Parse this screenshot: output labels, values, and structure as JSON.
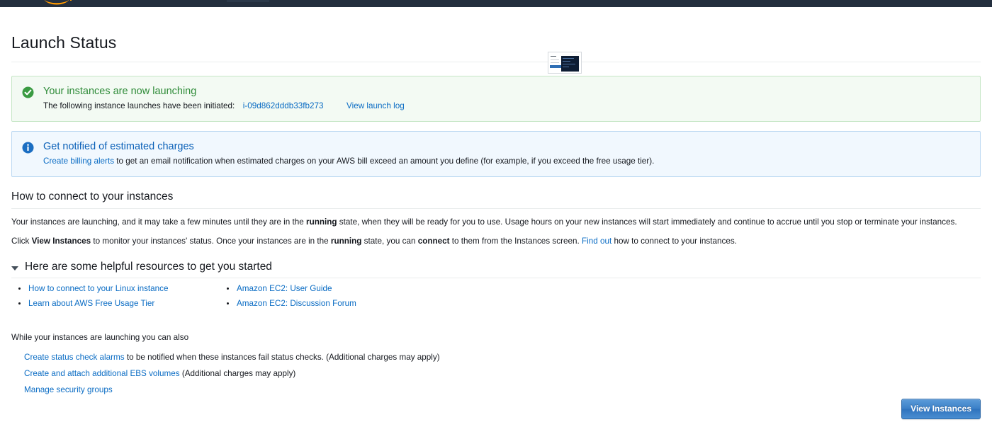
{
  "topbar": {
    "logo_label": "aws-smile-logo",
    "logo_color": "#ff9900",
    "background": "#232f3e"
  },
  "page": {
    "title": "Launch Status"
  },
  "thumbnail": {
    "label": "console-preview-thumbnail"
  },
  "success_alert": {
    "icon": "check-circle-icon",
    "icon_color": "#2e8b38",
    "heading": "Your instances are now launching",
    "description_prefix": "The following instance launches have been initiated:",
    "instance_id": "i-09d862dddb33fb273",
    "log_link": "View launch log"
  },
  "info_alert": {
    "icon": "info-circle-icon",
    "icon_color": "#1b6ec2",
    "heading": "Get notified of estimated charges",
    "link": "Create billing alerts",
    "description": "to get an email notification when estimated charges on your AWS bill exceed an amount you define (for example, if you exceed the free usage tier)."
  },
  "connect_section": {
    "heading": "How to connect to your instances",
    "paragraph1": {
      "part1": "Your instances are launching, and it may take a few minutes until they are in the",
      "bold1": "running",
      "part2": "state, when they will be ready for you to use. Usage hours on your new instances will start immediately and continue to accrue until you stop or terminate your instances."
    },
    "paragraph2": {
      "part1": "Click",
      "bold1": "View Instances",
      "part2": "to monitor your instances' status. Once your instances are in the",
      "bold2": "running",
      "part3": "state, you can",
      "bold3": "connect",
      "part4": "to them from the Instances screen.",
      "link": "Find out",
      "part5": "how to connect to your instances."
    }
  },
  "resources": {
    "heading": "Here are some helpful resources to get you started",
    "expanded": true,
    "column1": [
      {
        "label": "How to connect to your Linux instance"
      },
      {
        "label": "Learn about AWS Free Usage Tier"
      }
    ],
    "column2": [
      {
        "label": "Amazon EC2: User Guide"
      },
      {
        "label": "Amazon EC2: Discussion Forum"
      }
    ]
  },
  "also_section": {
    "title": "While your instances are launching you can also",
    "rows": [
      {
        "link": "Create status check alarms",
        "text": "to be notified when these instances fail status checks. (Additional charges may apply)"
      },
      {
        "link": "Create and attach additional EBS volumes",
        "text": "(Additional charges may apply)"
      },
      {
        "link": "Manage security groups",
        "text": ""
      }
    ]
  },
  "footer": {
    "view_instances_label": "View Instances",
    "button_color": "#3a7fc7"
  }
}
